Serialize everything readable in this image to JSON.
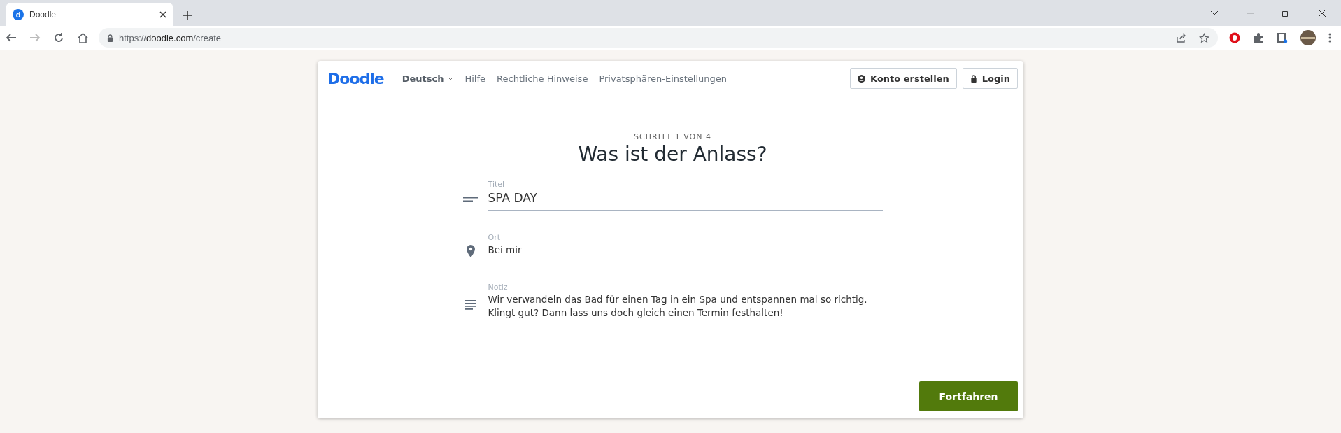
{
  "browser": {
    "tab": {
      "title": "Doodle",
      "favicon": "d"
    },
    "url": {
      "host": "https://doodle.com",
      "path": "/create"
    }
  },
  "header": {
    "logo": "Doodle",
    "language": "Deutsch",
    "links": [
      "Hilfe",
      "Rechtliche Hinweise",
      "Privatsphären-Einstellungen"
    ],
    "buttons": [
      {
        "kind": "account",
        "label": "Konto erstellen"
      },
      {
        "kind": "login",
        "label": "Login"
      }
    ]
  },
  "step": "SCHRITT 1 VON 4",
  "heading": "Was ist der Anlass?",
  "fields": [
    {
      "kind": "title",
      "label": "Titel",
      "value": "SPA DAY"
    },
    {
      "kind": "location",
      "label": "Ort",
      "value": "Bei mir"
    },
    {
      "kind": "note",
      "label": "Notiz",
      "value": "Wir verwandeln das Bad für einen Tag in ein Spa und entspannen mal so richtig.\nKlingt gut? Dann lass uns doch gleich einen Termin festhalten!"
    }
  ],
  "continue_button": "Fortfahren"
}
